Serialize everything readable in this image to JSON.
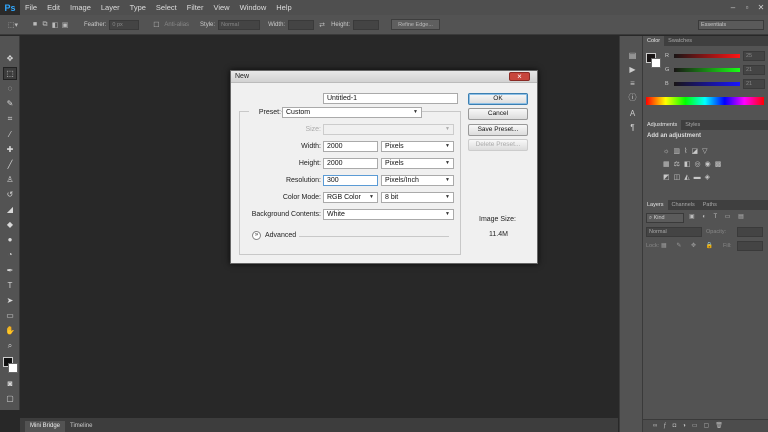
{
  "app": {
    "logo": "Ps"
  },
  "menu": [
    "File",
    "Edit",
    "Image",
    "Layer",
    "Type",
    "Select",
    "Filter",
    "View",
    "Window",
    "Help"
  ],
  "window_controls": [
    "–",
    "▫",
    "✕"
  ],
  "options": {
    "feather_label": "Feather:",
    "feather_value": "0 px",
    "antialias_label": "Anti-alias",
    "style_label": "Style:",
    "style_value": "Normal",
    "width_label": "Width:",
    "height_label": "Height:",
    "refine_label": "Refine Edge...",
    "workspace": "Essentials"
  },
  "bottom_tabs": [
    "Mini Bridge",
    "Timeline"
  ],
  "color_panel": {
    "tabs": [
      "Color",
      "Swatches"
    ],
    "channels": [
      {
        "name": "R",
        "value": "25"
      },
      {
        "name": "G",
        "value": "21"
      },
      {
        "name": "B",
        "value": "21"
      }
    ]
  },
  "adjustments_panel": {
    "tabs": [
      "Adjustments",
      "Styles"
    ],
    "title": "Add an adjustment"
  },
  "layers_panel": {
    "tabs": [
      "Layers",
      "Channels",
      "Paths"
    ],
    "kind": "Kind",
    "blend": "Normal",
    "opacity_label": "Opacity:",
    "lock_label": "Lock:",
    "fill_label": "Fill:"
  },
  "dialog": {
    "title": "New",
    "name_label": "Name:",
    "name_value": "Untitled-1",
    "preset_label": "Preset:",
    "preset_value": "Custom",
    "size_label": "Size:",
    "width_label": "Width:",
    "width_value": "2000",
    "width_unit": "Pixels",
    "height_label": "Height:",
    "height_value": "2000",
    "height_unit": "Pixels",
    "resolution_label": "Resolution:",
    "resolution_value": "300",
    "resolution_unit": "Pixels/Inch",
    "colormode_label": "Color Mode:",
    "colormode_value": "RGB Color",
    "bitdepth_value": "8 bit",
    "bg_label": "Background Contents:",
    "bg_value": "White",
    "advanced_label": "Advanced",
    "ok": "OK",
    "cancel": "Cancel",
    "save_preset": "Save Preset...",
    "delete_preset": "Delete Preset...",
    "image_size_label": "Image Size:",
    "image_size_value": "11.4M"
  }
}
